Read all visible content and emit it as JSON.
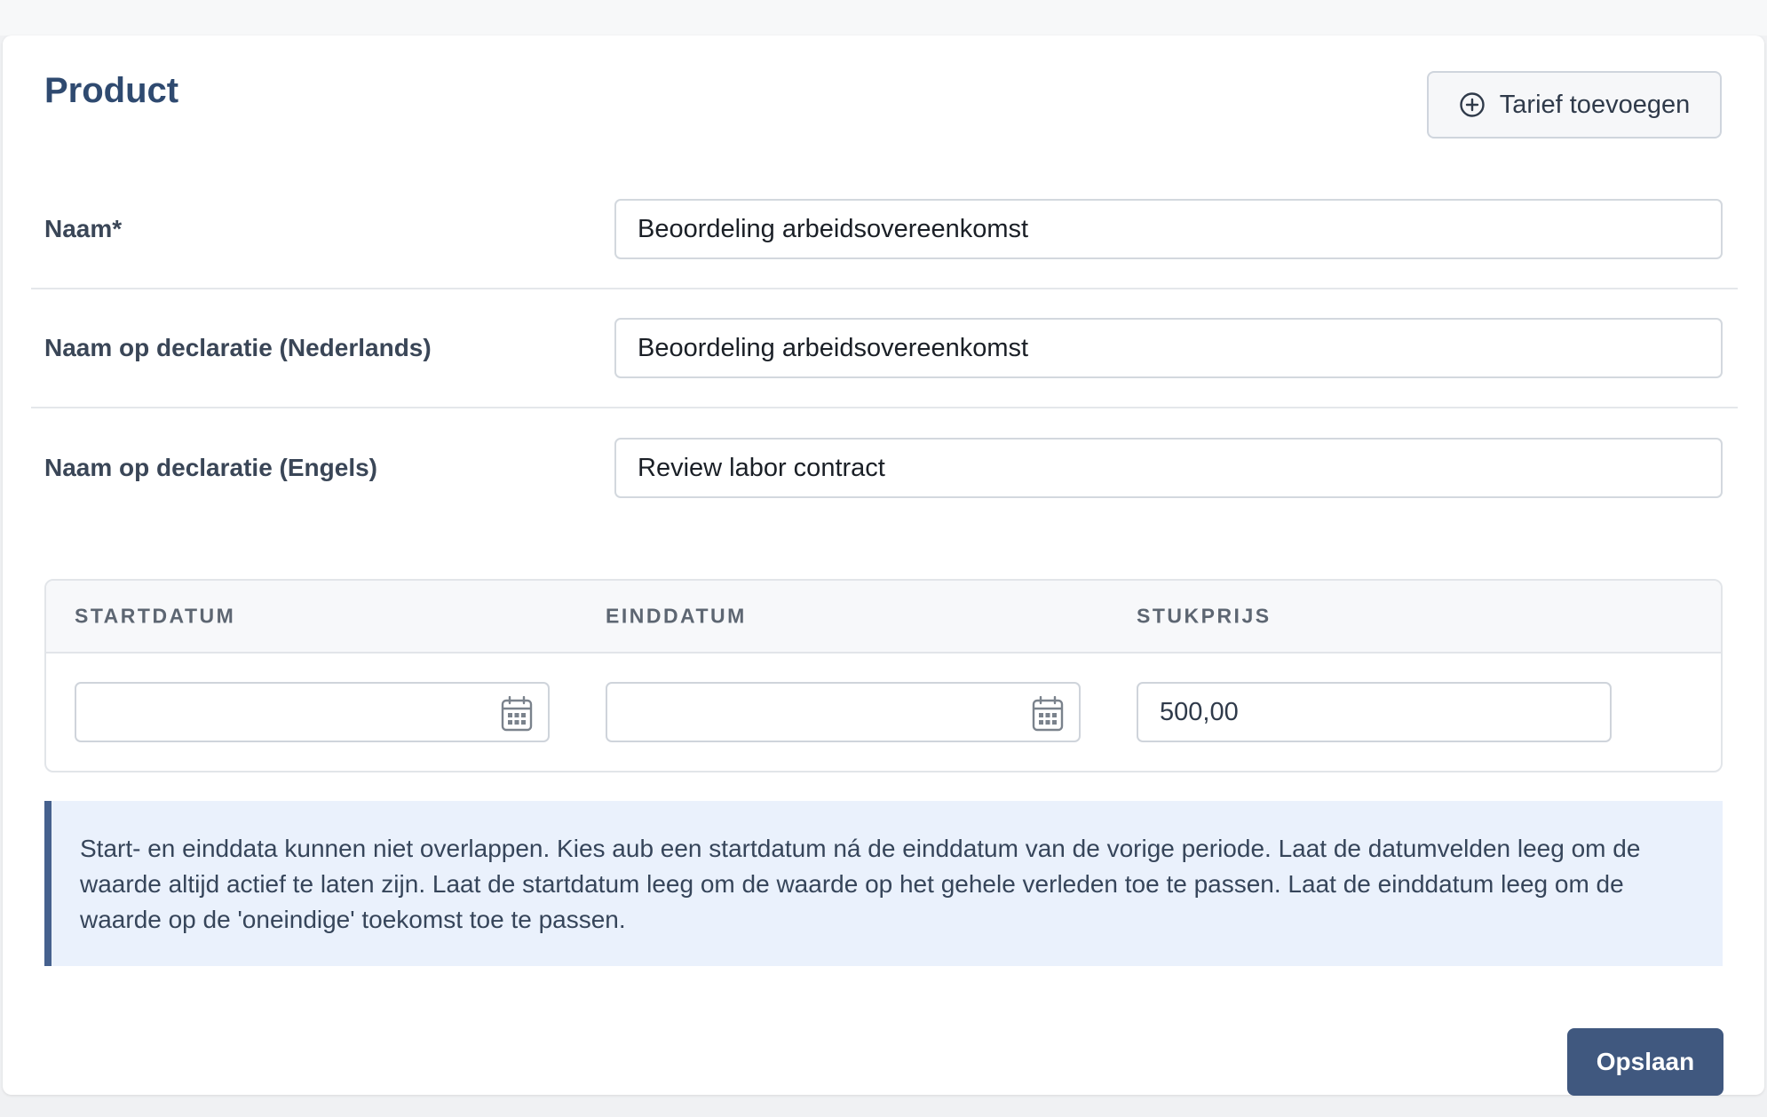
{
  "header": {
    "title": "Product",
    "add_tariff_label": "Tarief toevoegen"
  },
  "form": {
    "fields": [
      {
        "label": "Naam*",
        "value": "Beoordeling arbeidsovereenkomst"
      },
      {
        "label": "Naam op declaratie (Nederlands)",
        "value": "Beoordeling arbeidsovereenkomst"
      },
      {
        "label": "Naam op declaratie (Engels)",
        "value": "Review labor contract"
      }
    ]
  },
  "tariffs": {
    "columns": [
      "STARTDATUM",
      "EINDDATUM",
      "STUKPRIJS"
    ],
    "rows": [
      {
        "startdatum": "",
        "einddatum": "",
        "stukprijs": "500,00"
      }
    ]
  },
  "info": {
    "text": "Start- en einddata kunnen niet overlappen. Kies aub een startdatum ná de einddatum van de vorige periode. Laat de datumvelden leeg om de waarde altijd actief te laten zijn. Laat de startdatum leeg om de waarde op het gehele verleden toe te passen. Laat de einddatum leeg om de waarde op de 'oneindige' toekomst toe te passen."
  },
  "actions": {
    "save_label": "Opslaan"
  },
  "icons": {
    "add": "plus-circle-icon",
    "date": "calendar-icon"
  },
  "colors": {
    "primary": "#40587f",
    "title": "#2f4a70",
    "info_bg": "#eaf1fc",
    "info_border": "#46618e"
  }
}
